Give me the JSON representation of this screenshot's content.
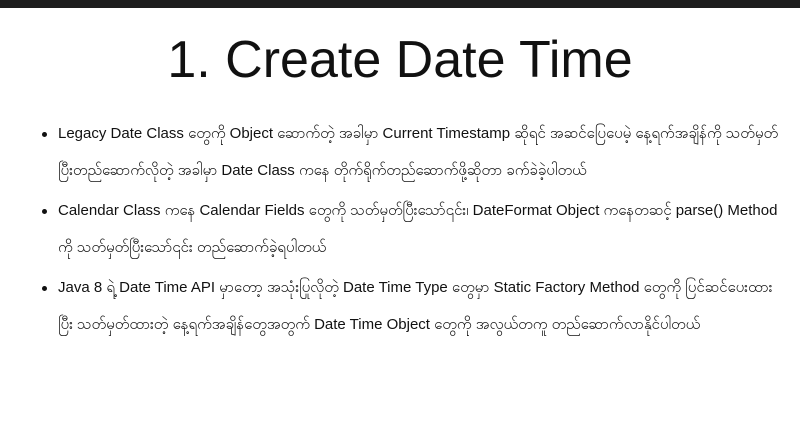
{
  "slide": {
    "title": "1. Create Date Time",
    "bullets": [
      "Legacy Date Class တွေကို Object ဆောက်တဲ့ အခါမှာ Current Timestamp ဆိုရင် အဆင်ပြေပေမဲ့ နေ့ရက်အချိန်ကို သတ်မှတ်ပြီးတည်ဆောက်လိုတဲ့ အခါမှာ Date Class ကနေ တိုက်ရိုက်တည်ဆောက်ဖို့ဆိုတာ ခက်ခဲခဲ့ပါတယ်",
      "Calendar Class ကနေ Calendar Fields တွေကို သတ်မှတ်ပြီးသော်၎င်း၊ DateFormat Object ကနေတဆင့် parse() Method ကို သတ်မှတ်ပြီးသော်၎င်း တည်ဆောက်ခဲ့ရပါတယ်",
      "Java 8 ရဲ့ Date Time API မှာတော့ အသုံးပြုလိုတဲ့ Date Time Type တွေမှာ Static Factory Method တွေကို ပြင်ဆင်ပေးထားပြီး သတ်မှတ်ထားတဲ့ နေ့ရက်အချိန်တွေအတွက် Date Time Object တွေကို အလွယ်တကူ တည်ဆောက်လာနိုင်ပါတယ်"
    ]
  }
}
